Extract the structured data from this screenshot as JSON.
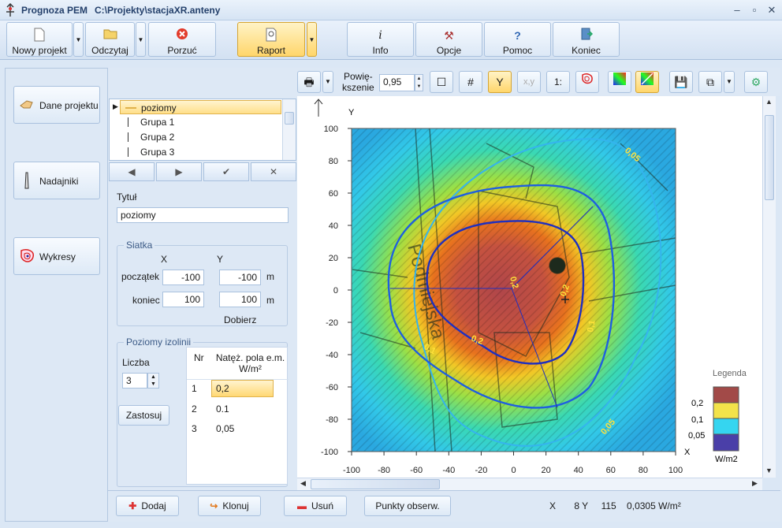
{
  "window": {
    "app_name": "Prognoza PEM",
    "file_path": "C:\\Projekty\\stacjaXR.anteny",
    "minimize": "–",
    "restore": "▫",
    "close": "✕"
  },
  "toolbar": {
    "new_project": "Nowy projekt",
    "open": "Odczytaj",
    "discard": "Porzuć",
    "report": "Raport",
    "info": "Info",
    "options": "Opcje",
    "help": "Pomoc",
    "exit": "Koniec"
  },
  "sidebar": {
    "project_data": "Dane projektu",
    "transmitters": "Nadajniki",
    "plots": "Wykresy"
  },
  "layers": {
    "items": [
      "poziomy",
      "Grupa 1",
      "Grupa 2",
      "Grupa 3"
    ],
    "selected": "poziomy"
  },
  "nav": {
    "prev": "◀",
    "next": "▶",
    "confirm": "✔",
    "cancel": "✕"
  },
  "form": {
    "title_label": "Tytuł",
    "title_value": "poziomy",
    "grid_group": "Siatka",
    "col_x": "X",
    "col_y": "Y",
    "start_label": "początek",
    "end_label": "koniec",
    "start_x": "-100",
    "start_y": "-100",
    "end_x": "100",
    "end_y": "100",
    "unit": "m",
    "fit_button": "Dobierz",
    "iso_group": "Poziomy izolinii",
    "count_label": "Liczba",
    "count_value": "3",
    "apply_button": "Zastosuj"
  },
  "iso_table": {
    "col_nr": "Nr",
    "col_value": "Natęż. pola e.m. W/m²",
    "rows": [
      {
        "nr": "1",
        "value": "0,2"
      },
      {
        "nr": "2",
        "value": "0.1"
      },
      {
        "nr": "3",
        "value": "0,05"
      }
    ]
  },
  "bottom": {
    "add": "Dodaj",
    "clone": "Klonuj",
    "delete": "Usuń",
    "points": "Punkty obserw.",
    "status": "X       8 Y     115    0,0305 W/m²"
  },
  "chart_toolbar": {
    "zoom_label": "Powię-\nkszenie",
    "zoom_value": "0,95",
    "scale_label": "1:"
  },
  "chart_data": {
    "type": "heatmap",
    "xlabel": "X",
    "ylabel": "Y",
    "xlim": [
      -100,
      100
    ],
    "ylim": [
      -100,
      100
    ],
    "x_ticks": [
      -100,
      -80,
      -60,
      -40,
      -20,
      0,
      20,
      40,
      60,
      80,
      100
    ],
    "y_ticks": [
      -100,
      -80,
      -60,
      -40,
      -20,
      0,
      20,
      40,
      60,
      80,
      100
    ],
    "contours": [
      {
        "level": "0,2",
        "color": "#1f2fbf"
      },
      {
        "level": "0.1",
        "color": "#1e5fe0"
      },
      {
        "level": "0,05",
        "color": "#2fa0e8"
      }
    ],
    "contour_labels": [
      "0,05",
      "0,2",
      "0,2",
      "0,1",
      "0,2",
      "0,1",
      "0,05",
      "0,1"
    ],
    "map_text": "Podmiejska",
    "legend": {
      "title": "Legenda",
      "unit": "W/m2",
      "labels": [
        "0,2",
        "0,1",
        "0,05"
      ],
      "colors": [
        "#a24a48",
        "#f3e34a",
        "#35d5f0",
        "#4a3fa8"
      ]
    }
  }
}
